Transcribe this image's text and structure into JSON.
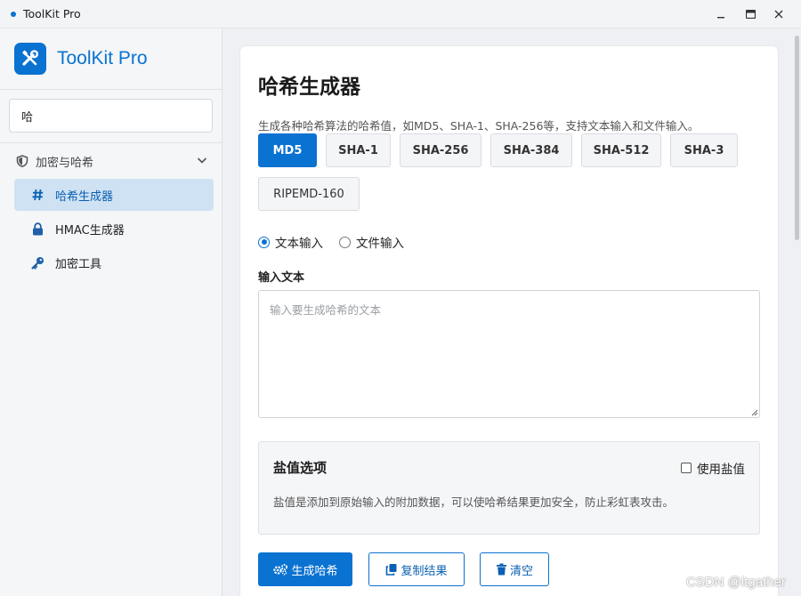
{
  "window": {
    "title": "ToolKit Pro"
  },
  "sidebar": {
    "brand": "ToolKit Pro",
    "search": {
      "value": "哈",
      "placeholder": ""
    },
    "group": {
      "label": "加密与哈希",
      "expanded": true
    },
    "items": [
      {
        "label": "哈希生成器",
        "icon": "hash-icon",
        "active": true
      },
      {
        "label": "HMAC生成器",
        "icon": "lock-icon",
        "active": false
      },
      {
        "label": "加密工具",
        "icon": "key-icon",
        "active": false
      }
    ]
  },
  "main": {
    "title": "哈希生成器",
    "description": "生成各种哈希算法的哈希值，如MD5、SHA-1、SHA-256等，支持文本输入和文件输入。",
    "algorithms": [
      "MD5",
      "SHA-1",
      "SHA-256",
      "SHA-384",
      "SHA-512",
      "SHA-3",
      "RIPEMD-160"
    ],
    "selected_algorithm": "MD5",
    "input_modes": {
      "text": "文本输入",
      "file": "文件输入",
      "selected": "text"
    },
    "input_label": "输入文本",
    "input_placeholder": "输入要生成哈希的文本",
    "input_value": "",
    "salt": {
      "title": "盐值选项",
      "toggle_label": "使用盐值",
      "enabled": false,
      "description": "盐值是添加到原始输入的附加数据，可以使哈希结果更加安全，防止彩虹表攻击。"
    },
    "buttons": {
      "generate": "生成哈希",
      "copy": "复制结果",
      "clear": "清空"
    }
  },
  "watermark": "CSDN @itgather",
  "colors": {
    "accent": "#0a72d1",
    "active_nav_bg": "#cfe2f3"
  }
}
